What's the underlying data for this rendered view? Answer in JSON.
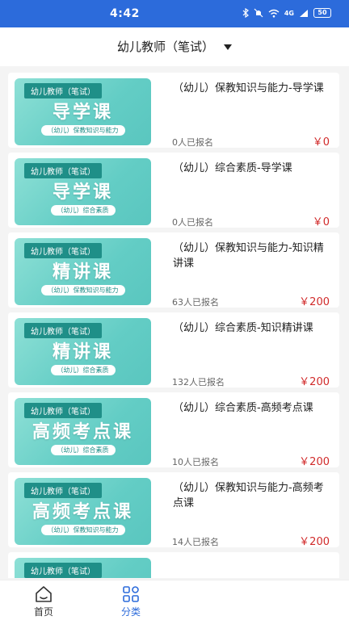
{
  "status_bar": {
    "time": "4:42",
    "network": "4G",
    "battery": "50"
  },
  "header": {
    "title": "幼儿教师（笔试）"
  },
  "courses": [
    {
      "tag": "幼儿教师（笔试）",
      "thumb_title": "导学课",
      "thumb_sub": "（幼儿）保教知识与能力",
      "title": "（幼儿）保教知识与能力-导学课",
      "count": "0人已报名",
      "price": "￥0"
    },
    {
      "tag": "幼儿教师（笔试）",
      "thumb_title": "导学课",
      "thumb_sub": "（幼儿）综合素质",
      "title": "（幼儿）综合素质-导学课",
      "count": "0人已报名",
      "price": "￥0"
    },
    {
      "tag": "幼儿教师（笔试）",
      "thumb_title": "精讲课",
      "thumb_sub": "（幼儿）保教知识与能力",
      "title": "（幼儿）保教知识与能力-知识精讲课",
      "count": "63人已报名",
      "price": "￥200"
    },
    {
      "tag": "幼儿教师（笔试）",
      "thumb_title": "精讲课",
      "thumb_sub": "（幼儿）综合素质",
      "title": "（幼儿）综合素质-知识精讲课",
      "count": "132人已报名",
      "price": "￥200"
    },
    {
      "tag": "幼儿教师（笔试）",
      "thumb_title": "高频考点课",
      "thumb_sub": "（幼儿）综合素质",
      "title": "（幼儿）综合素质-高频考点课",
      "count": "10人已报名",
      "price": "￥200"
    },
    {
      "tag": "幼儿教师（笔试）",
      "thumb_title": "高频考点课",
      "thumb_sub": "（幼儿）保教知识与能力",
      "title": "（幼儿）保教知识与能力-高频考点课",
      "count": "14人已报名",
      "price": "￥200"
    },
    {
      "tag": "幼儿教师（笔试）",
      "thumb_title": "",
      "thumb_sub": "",
      "title": "",
      "count": "",
      "price": ""
    }
  ],
  "tabbar": {
    "home": {
      "label": "首页",
      "icon": "home-icon"
    },
    "category": {
      "label": "分类",
      "icon": "category-grid-icon"
    }
  },
  "colors": {
    "primary": "#2c6bdb",
    "price": "#d12a2a",
    "thumb": "#63cdc5"
  }
}
